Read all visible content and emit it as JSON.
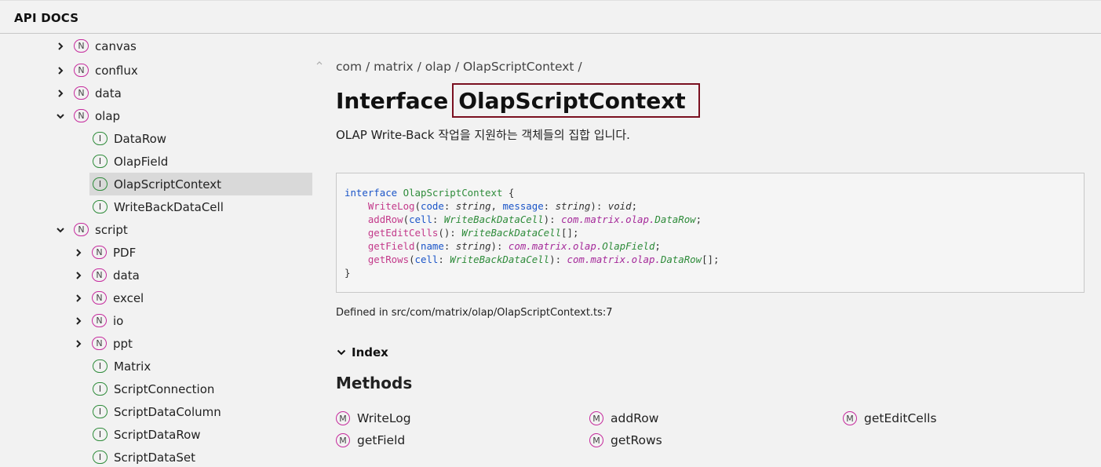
{
  "header": {
    "brand": "API DOCS"
  },
  "sidebar": {
    "items": [
      {
        "label": "canvas",
        "badge": "N",
        "kind": "namespace",
        "expanded": false,
        "depth": 0
      },
      {
        "label": "conflux",
        "badge": "N",
        "kind": "namespace",
        "expanded": false,
        "depth": 0
      },
      {
        "label": "data",
        "badge": "N",
        "kind": "namespace",
        "expanded": false,
        "depth": 0
      },
      {
        "label": "olap",
        "badge": "N",
        "kind": "namespace",
        "expanded": true,
        "depth": 0
      },
      {
        "label": "DataRow",
        "badge": "I",
        "kind": "interface",
        "depth": 1
      },
      {
        "label": "OlapField",
        "badge": "I",
        "kind": "interface",
        "depth": 1
      },
      {
        "label": "OlapScriptContext",
        "badge": "I",
        "kind": "interface",
        "depth": 1,
        "selected": true
      },
      {
        "label": "WriteBackDataCell",
        "badge": "I",
        "kind": "interface",
        "depth": 1
      },
      {
        "label": "script",
        "badge": "N",
        "kind": "namespace",
        "expanded": true,
        "depth": 0
      },
      {
        "label": "PDF",
        "badge": "N",
        "kind": "namespace",
        "expanded": false,
        "depth": 1
      },
      {
        "label": "data",
        "badge": "N",
        "kind": "namespace",
        "expanded": false,
        "depth": 1
      },
      {
        "label": "excel",
        "badge": "N",
        "kind": "namespace",
        "expanded": false,
        "depth": 1
      },
      {
        "label": "io",
        "badge": "N",
        "kind": "namespace",
        "expanded": false,
        "depth": 1
      },
      {
        "label": "ppt",
        "badge": "N",
        "kind": "namespace",
        "expanded": false,
        "depth": 1
      },
      {
        "label": "Matrix",
        "badge": "I",
        "kind": "interface",
        "depth": 1
      },
      {
        "label": "ScriptConnection",
        "badge": "I",
        "kind": "interface",
        "depth": 1
      },
      {
        "label": "ScriptDataColumn",
        "badge": "I",
        "kind": "interface",
        "depth": 1
      },
      {
        "label": "ScriptDataRow",
        "badge": "I",
        "kind": "interface",
        "depth": 1
      },
      {
        "label": "ScriptDataSet",
        "badge": "I",
        "kind": "interface",
        "depth": 1
      }
    ]
  },
  "main": {
    "breadcrumb": "com / matrix / olap / OlapScriptContext /",
    "kind": "Interface",
    "name": "OlapScriptContext",
    "description": "OLAP Write-Back 작업을 지원하는 객체들의 집합 입니다.",
    "code": {
      "kw_interface": "interface",
      "iface_name": "OlapScriptContext",
      "open_brace": "{",
      "close_brace": "}",
      "writelog": "WriteLog",
      "addrow": "addRow",
      "geteditcells": "getEditCells",
      "getfield": "getField",
      "getrows": "getRows",
      "p_code": "code",
      "p_message": "message",
      "p_cell": "cell",
      "p_name": "name",
      "t_string": "string",
      "t_void": "void",
      "t_wbdc": "WriteBackDataCell",
      "ns_path": "com.matrix.olap.",
      "t_datarow": "DataRow",
      "t_olapfield": "OlapField"
    },
    "defined_in": "Defined in src/com/matrix/olap/OlapScriptContext.ts:7",
    "index_label": "Index",
    "methods_title": "Methods",
    "methods": [
      "WriteLog",
      "addRow",
      "getEditCells",
      "getField",
      "getRows"
    ],
    "method_badge": "M"
  },
  "colors": {
    "namespace_badge": "#c62a9d",
    "interface_badge": "#2e8b3a",
    "highlight_box": "#7a1020",
    "selected_row": "#d9d9d9"
  },
  "icons": {
    "expand": "chevron-right-icon",
    "collapse": "chevron-down-icon",
    "index_toggle": "chevron-down-icon"
  }
}
